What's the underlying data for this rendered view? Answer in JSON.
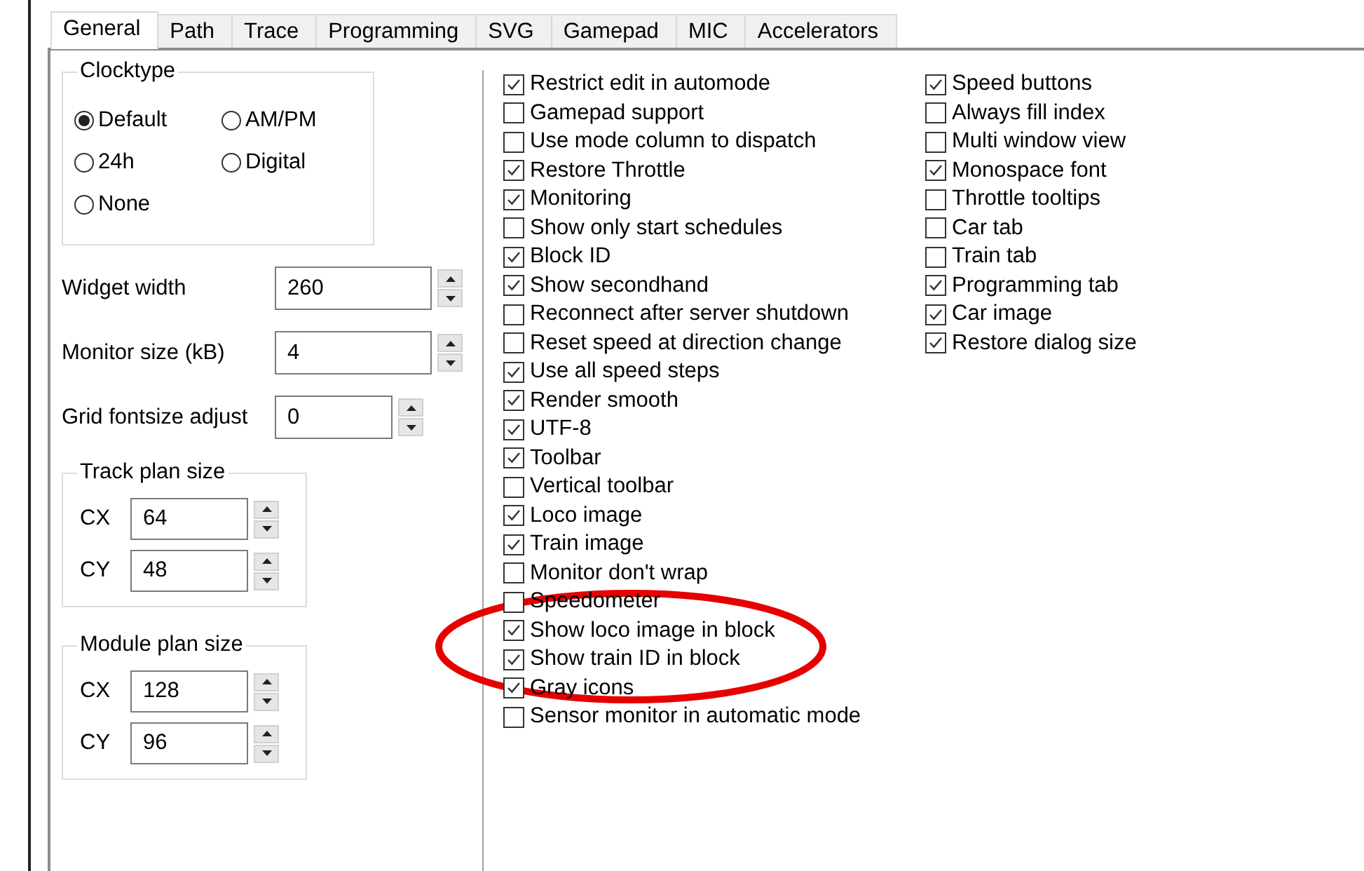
{
  "tabs": [
    {
      "label": "General",
      "selected": true
    },
    {
      "label": "Path",
      "selected": false
    },
    {
      "label": "Trace",
      "selected": false
    },
    {
      "label": "Programming",
      "selected": false
    },
    {
      "label": "SVG",
      "selected": false
    },
    {
      "label": "Gamepad",
      "selected": false
    },
    {
      "label": "MIC",
      "selected": false
    },
    {
      "label": "Accelerators",
      "selected": false
    }
  ],
  "clocktype": {
    "title": "Clocktype",
    "options": [
      {
        "label": "Default",
        "selected": true
      },
      {
        "label": "AM/PM",
        "selected": false
      },
      {
        "label": "24h",
        "selected": false
      },
      {
        "label": "Digital",
        "selected": false
      },
      {
        "label": "None",
        "selected": false
      }
    ]
  },
  "spinners": [
    {
      "label": "Widget width",
      "value": "260",
      "kind": "wide"
    },
    {
      "label": "Monitor size (kB)",
      "value": "4",
      "kind": "wide"
    },
    {
      "label": "Grid fontsize adjust",
      "value": "0",
      "kind": "narrow"
    }
  ],
  "size_groups": [
    {
      "title": "Track plan size",
      "fields": [
        {
          "label": "CX",
          "value": "64"
        },
        {
          "label": "CY",
          "value": "48"
        }
      ]
    },
    {
      "title": "Module plan size",
      "fields": [
        {
          "label": "CX",
          "value": "128"
        },
        {
          "label": "CY",
          "value": "96"
        }
      ]
    }
  ],
  "options_column_1": [
    {
      "label": "Restrict edit in automode",
      "checked": true
    },
    {
      "label": "Gamepad support",
      "checked": false
    },
    {
      "label": "Use mode column to dispatch",
      "checked": false
    },
    {
      "label": "Restore Throttle",
      "checked": true
    },
    {
      "label": "Monitoring",
      "checked": true
    },
    {
      "label": "Show only start schedules",
      "checked": false
    },
    {
      "label": "Block ID",
      "checked": true
    },
    {
      "label": "Show secondhand",
      "checked": true
    },
    {
      "label": "Reconnect after server shutdown",
      "checked": false
    },
    {
      "label": "Reset speed at direction change",
      "checked": false
    },
    {
      "label": "Use all speed steps",
      "checked": true
    },
    {
      "label": "Render smooth",
      "checked": true
    },
    {
      "label": "UTF-8",
      "checked": true
    },
    {
      "label": "Toolbar",
      "checked": true
    },
    {
      "label": "Vertical toolbar",
      "checked": false
    },
    {
      "label": "Loco image",
      "checked": true
    },
    {
      "label": "Train image",
      "checked": true
    },
    {
      "label": "Monitor don't wrap",
      "checked": false
    },
    {
      "label": "Speedometer",
      "checked": false
    },
    {
      "label": "Show loco image in block",
      "checked": true,
      "highlighted": true
    },
    {
      "label": "Show train ID in block",
      "checked": true,
      "highlighted": true
    },
    {
      "label": "Gray icons",
      "checked": true
    },
    {
      "label": "Sensor monitor in automatic mode",
      "checked": false
    }
  ],
  "options_column_2": [
    {
      "label": "Speed buttons",
      "checked": true
    },
    {
      "label": "Always fill index",
      "checked": false
    },
    {
      "label": "Multi window view",
      "checked": false
    },
    {
      "label": "Monospace font",
      "checked": true
    },
    {
      "label": "Throttle tooltips",
      "checked": false
    },
    {
      "label": "Car tab",
      "checked": false
    },
    {
      "label": "Train tab",
      "checked": false
    },
    {
      "label": "Programming tab",
      "checked": true
    },
    {
      "label": "Car image",
      "checked": true
    },
    {
      "label": "Restore dialog size",
      "checked": true
    }
  ]
}
